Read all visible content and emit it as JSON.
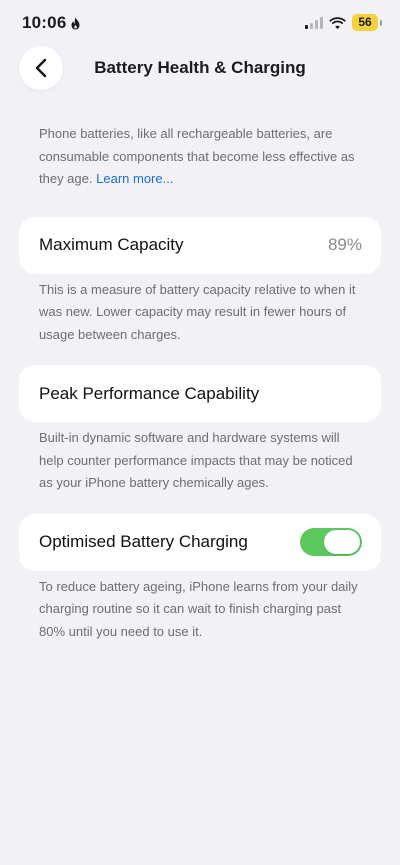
{
  "status_bar": {
    "time": "10:06",
    "battery_level": "56",
    "signal_icon": "cellular-signal-icon",
    "wifi_icon": "wifi-icon",
    "focus_icon": "flame-icon"
  },
  "nav": {
    "title": "Battery Health & Charging",
    "back_icon": "chevron-left-icon"
  },
  "intro": {
    "text": "Phone batteries, like all rechargeable batteries, are consumable components that become less effective as they age.",
    "link": "Learn more..."
  },
  "max_capacity": {
    "label": "Maximum Capacity",
    "value": "89%",
    "footer": "This is a measure of battery capacity relative to when it was new. Lower capacity may result in fewer hours of usage between charges."
  },
  "peak_performance": {
    "label": "Peak Performance Capability",
    "footer": "Built-in dynamic software and hardware systems will help counter performance impacts that may be noticed as your iPhone battery chemically ages."
  },
  "optimised_charging": {
    "label": "Optimised Battery Charging",
    "enabled": true,
    "footer": "To reduce battery ageing, iPhone learns from your daily charging routine so it can wait to finish charging past 80% until you need to use it."
  },
  "colors": {
    "background": "#f2f1f6",
    "toggle_on": "#5cc85e",
    "link": "#1f6fd1",
    "battery": "#f3d23a"
  }
}
